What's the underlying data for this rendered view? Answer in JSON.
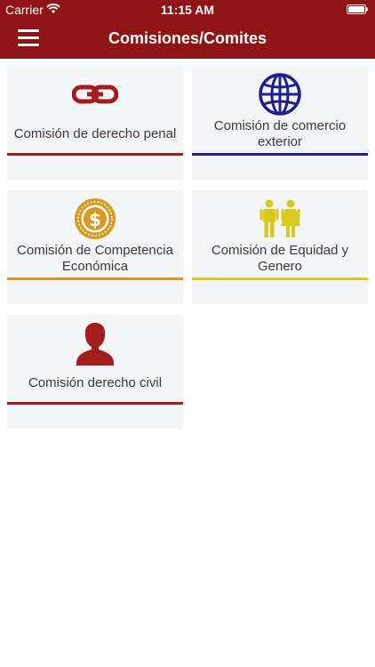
{
  "status_bar": {
    "carrier": "Carrier",
    "time": "11:15 AM",
    "wifi_icon": "wifi-icon",
    "battery_icon": "battery-icon"
  },
  "nav": {
    "title": "Comisiones/Comites",
    "menu_icon": "hamburger-menu-icon"
  },
  "colors": {
    "header_bg": "#8e1416",
    "card_bg": "#f4f5f7"
  },
  "cards": [
    {
      "label": "Comisión de derecho penal",
      "icon": "chain-link-icon",
      "color": "#a31d1f"
    },
    {
      "label": "Comisión de comercio exterior",
      "icon": "globe-icon",
      "color": "#1f1f8e"
    },
    {
      "label": "Comisión de Competencia Económica",
      "icon": "dollar-coin-icon",
      "color": "#d79a22"
    },
    {
      "label": "Comisión de Equidad y Genero",
      "icon": "man-woman-icon",
      "color": "#d8c820"
    },
    {
      "label": "Comisión derecho civil",
      "icon": "person-icon",
      "color": "#a31d1f"
    }
  ]
}
